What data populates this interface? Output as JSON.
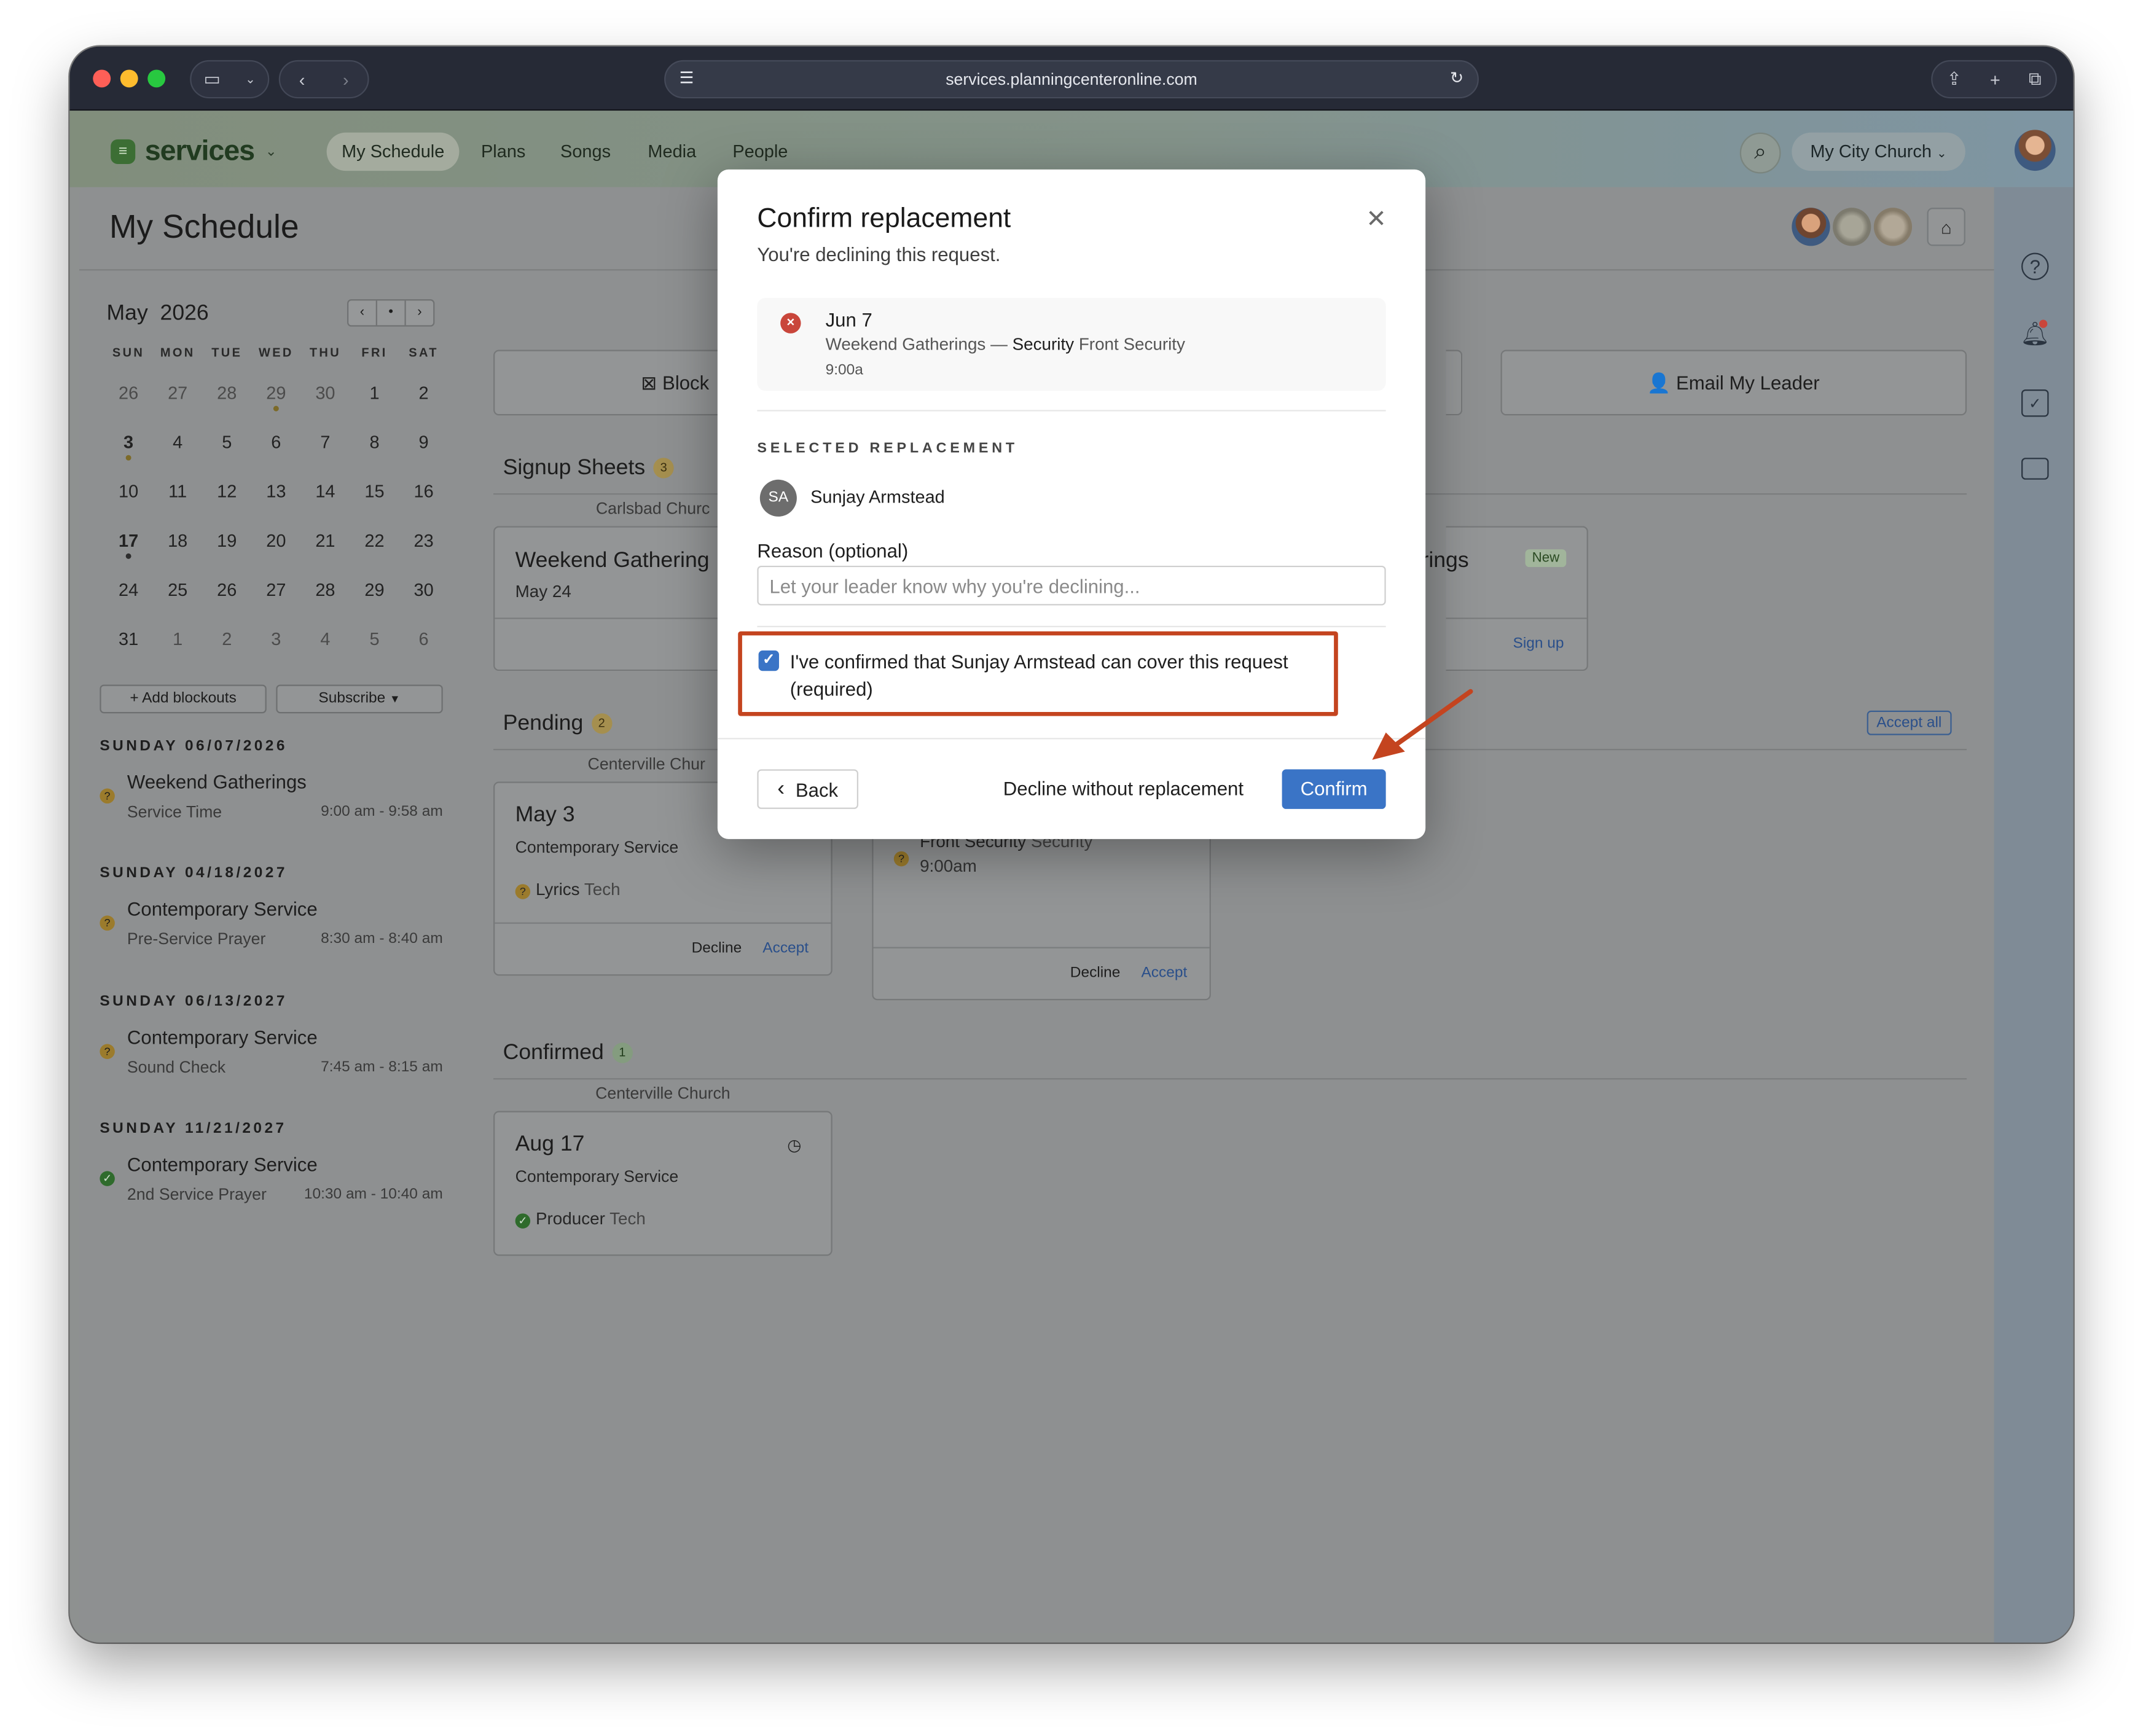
{
  "browser": {
    "url": "services.planningcenteronline.com"
  },
  "app": {
    "name": "services",
    "nav": [
      "My Schedule",
      "Plans",
      "Songs",
      "Media",
      "People"
    ],
    "church": "My City Church"
  },
  "page": {
    "title": "My Schedule"
  },
  "calendar": {
    "month": "May",
    "year": "2026",
    "weekdays": [
      "SUN",
      "MON",
      "TUE",
      "WED",
      "THU",
      "FRI",
      "SAT"
    ],
    "weeks": [
      [
        "26",
        "27",
        "28",
        "29",
        "30",
        "1",
        "2"
      ],
      [
        "3",
        "4",
        "5",
        "6",
        "7",
        "8",
        "9"
      ],
      [
        "10",
        "11",
        "12",
        "13",
        "14",
        "15",
        "16"
      ],
      [
        "17",
        "18",
        "19",
        "20",
        "21",
        "22",
        "23"
      ],
      [
        "24",
        "25",
        "26",
        "27",
        "28",
        "29",
        "30"
      ],
      [
        "31",
        "1",
        "2",
        "3",
        "4",
        "5",
        "6"
      ]
    ],
    "add_blockouts": "Add blockouts",
    "subscribe": "Subscribe"
  },
  "schedule": [
    {
      "date": "SUNDAY 06/07/2026",
      "title": "Weekend Gatherings",
      "sub": "Service Time",
      "time": "9:00 am - 9:58 am",
      "status": "pending"
    },
    {
      "date": "SUNDAY 04/18/2027",
      "title": "Contemporary Service",
      "sub": "Pre-Service Prayer",
      "time": "8:30 am - 8:40 am",
      "status": "pending"
    },
    {
      "date": "SUNDAY 06/13/2027",
      "title": "Contemporary Service",
      "sub": "Sound Check",
      "time": "7:45 am - 8:15 am",
      "status": "pending"
    },
    {
      "date": "SUNDAY 11/21/2027",
      "title": "Contemporary Service",
      "sub": "2nd Service Prayer",
      "time": "10:30 am - 10:40 am",
      "status": "confirmed"
    }
  ],
  "actions": {
    "block": "Block",
    "email_leader": "Email My Leader"
  },
  "signup": {
    "title": "Signup Sheets",
    "count": "3",
    "church": "Carlsbad Churc",
    "card_title": "Weekend Gathering",
    "card_date": "May 24",
    "card2_title": "rings",
    "new_badge": "New",
    "sign_up": "Sign up"
  },
  "pending": {
    "title": "Pending",
    "count": "2",
    "accept_all": "Accept all",
    "church": "Centerville Chur",
    "card1": {
      "date": "May 3",
      "service": "Contemporary Service",
      "role": "Lyrics",
      "team": "Tech",
      "decline": "Decline",
      "accept": "Accept"
    },
    "card2": {
      "role": "Front Security",
      "team": "Security",
      "time": "9:00am",
      "decline": "Decline",
      "accept": "Accept"
    }
  },
  "confirmed": {
    "title": "Confirmed",
    "count": "1",
    "church": "Centerville Church",
    "card": {
      "date": "Aug 17",
      "service": "Contemporary Service",
      "role": "Producer",
      "team": "Tech"
    }
  },
  "modal": {
    "title": "Confirm replacement",
    "subtitle": "You're declining this request.",
    "request": {
      "date": "Jun 7",
      "service": "Weekend Gatherings",
      "separator": "—",
      "team": "Security",
      "position": "Front Security",
      "time": "9:00a"
    },
    "replacement_label": "SELECTED REPLACEMENT",
    "replacement_initials": "SA",
    "replacement_name": "Sunjay Armstead",
    "reason_label": "Reason (optional)",
    "reason_placeholder": "Let your leader know why you're declining...",
    "confirm_check_line1": "I've confirmed that Sunjay Armstead can cover this request",
    "confirm_check_line2": "(required)",
    "back": "Back",
    "decline_without": "Decline without replacement",
    "confirm": "Confirm"
  },
  "colors": {
    "primary": "#3a74c6",
    "danger": "#c9463b",
    "highlight": "#c4441f",
    "pending": "#c6962c",
    "confirmed": "#3e8a3a"
  }
}
